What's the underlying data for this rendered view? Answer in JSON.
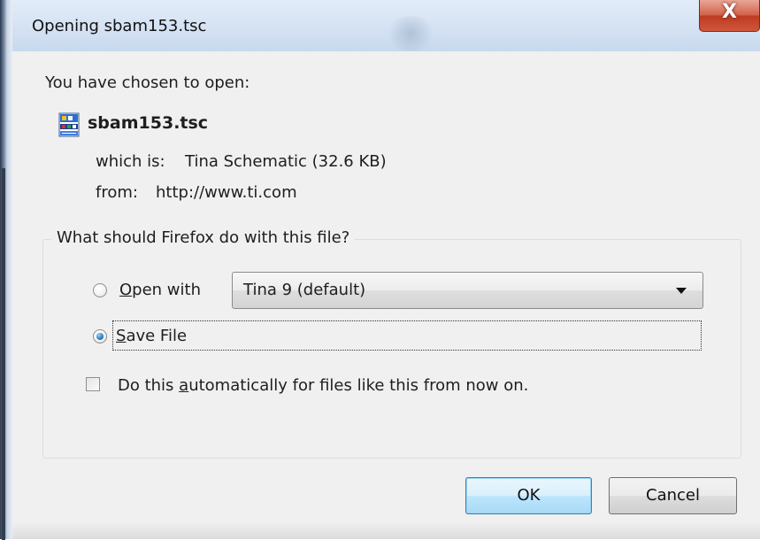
{
  "window": {
    "title": "Opening sbam153.tsc",
    "close_label": "X"
  },
  "intro": "You have chosen to open:",
  "file": {
    "name": "sbam153.tsc",
    "icon": "tina-schematic-file-icon",
    "which_is_label": "which is:",
    "which_is_value": "Tina Schematic (32.6 KB)",
    "from_label": "from:",
    "from_value": "http://www.ti.com"
  },
  "action_group": {
    "legend": "What should Firefox do with this file?",
    "open_with": {
      "label_mnemonic": "O",
      "label_rest": "pen with",
      "selected": false
    },
    "application_select": {
      "value": "Tina 9 (default)"
    },
    "save_file": {
      "label_mnemonic": "S",
      "label_rest": "ave File",
      "selected": true
    },
    "auto_checkbox": {
      "label_before": "Do this ",
      "label_mnemonic": "a",
      "label_after": "utomatically for files like this from now on.",
      "checked": false
    }
  },
  "buttons": {
    "ok": "OK",
    "cancel": "Cancel"
  },
  "colors": {
    "titlebar": "#d4e2f3",
    "client": "#f0f0f0",
    "close_button": "#c9452b",
    "default_button_border": "#3c7fb1"
  }
}
